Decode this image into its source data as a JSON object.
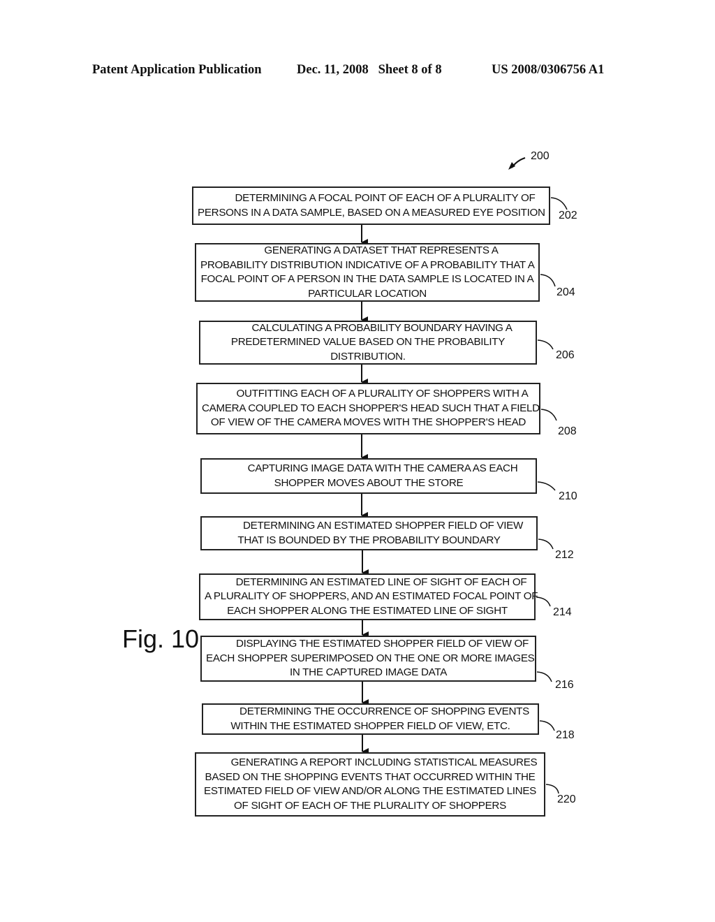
{
  "header": {
    "left": "Patent Application Publication",
    "middle": "Dec. 11, 2008   Sheet 8 of 8",
    "right": "US 2008/0306756 A1"
  },
  "figure": {
    "label": "Fig. 10",
    "ref": "200",
    "steps": [
      {
        "ref": "202",
        "lines": [
          "DETERMINING A FOCAL POINT OF EACH OF A PLURALITY OF",
          "PERSONS IN A DATA SAMPLE, BASED ON A MEASURED EYE POSITION"
        ]
      },
      {
        "ref": "204",
        "lines": [
          "GENERATING A DATASET THAT REPRESENTS A",
          "PROBABILITY DISTRIBUTION INDICATIVE OF A PROBABILITY THAT A",
          "FOCAL POINT OF A PERSON IN THE DATA SAMPLE IS LOCATED IN A",
          "PARTICULAR LOCATION"
        ]
      },
      {
        "ref": "206",
        "lines": [
          "CALCULATING A PROBABILITY BOUNDARY HAVING  A",
          "PREDETERMINED VALUE BASED ON THE PROBABILITY",
          "DISTRIBUTION."
        ]
      },
      {
        "ref": "208",
        "lines": [
          "OUTFITTING EACH OF A PLURALITY OF SHOPPERS WITH A",
          "CAMERA COUPLED TO EACH SHOPPER'S HEAD SUCH THAT A FIELD",
          "OF VIEW OF THE CAMERA MOVES WITH THE SHOPPER'S HEAD"
        ]
      },
      {
        "ref": "210",
        "lines": [
          "CAPTURING IMAGE DATA WITH THE CAMERA AS EACH",
          "SHOPPER MOVES ABOUT THE STORE"
        ]
      },
      {
        "ref": "212",
        "lines": [
          "DETERMINING AN ESTIMATED SHOPPER FIELD OF VIEW",
          "THAT IS BOUNDED BY THE PROBABILITY BOUNDARY"
        ]
      },
      {
        "ref": "214",
        "lines": [
          "DETERMINING AN ESTIMATED LINE OF SIGHT OF EACH OF",
          "A PLURALITY OF SHOPPERS, AND AN ESTIMATED FOCAL POINT OF",
          "EACH SHOPPER ALONG THE ESTIMATED LINE OF SIGHT"
        ]
      },
      {
        "ref": "216",
        "lines": [
          "DISPLAYING THE ESTIMATED SHOPPER FIELD OF VIEW OF",
          "EACH SHOPPER SUPERIMPOSED ON THE ONE OR MORE IMAGES",
          "IN THE CAPTURED IMAGE DATA"
        ]
      },
      {
        "ref": "218",
        "lines": [
          "DETERMINING THE OCCURRENCE OF SHOPPING EVENTS",
          "WITHIN THE ESTIMATED SHOPPER FIELD OF VIEW, ETC."
        ]
      },
      {
        "ref": "220",
        "lines": [
          "GENERATING A REPORT INCLUDING STATISTICAL MEASURES",
          "BASED ON THE SHOPPING EVENTS THAT OCCURRED WITHIN THE",
          "ESTIMATED FIELD OF VIEW AND/OR ALONG THE ESTIMATED LINES",
          "OF SIGHT OF EACH OF THE PLURALITY OF SHOPPERS"
        ]
      }
    ]
  }
}
